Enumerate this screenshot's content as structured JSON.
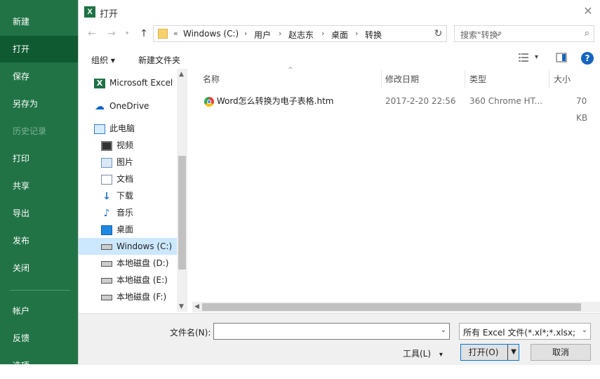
{
  "backstage": {
    "items": [
      {
        "label": "新建"
      },
      {
        "label": "打开"
      },
      {
        "label": "保存"
      },
      {
        "label": "另存为"
      },
      {
        "label": "历史记录"
      },
      {
        "label": "打印"
      },
      {
        "label": "共享"
      },
      {
        "label": "导出"
      },
      {
        "label": "发布"
      },
      {
        "label": "关闭"
      },
      {
        "label": "帐户"
      },
      {
        "label": "反馈"
      },
      {
        "label": "选项"
      }
    ],
    "active": "打开",
    "accent": "#217346"
  },
  "dialog": {
    "title": "打开",
    "address": {
      "prefix": "«",
      "crumbs": [
        "Windows (C:)",
        "用户",
        "赵志东",
        "桌面",
        "转换"
      ]
    },
    "search_placeholder": "搜索\"转换\"",
    "toolbar": {
      "organize": "组织 ▾",
      "new_folder": "新建文件夹"
    },
    "nav": [
      {
        "label": "Microsoft Excel",
        "icon": "excel-icon"
      },
      {
        "label": "OneDrive",
        "icon": "cloud-icon"
      },
      {
        "label": "此电脑",
        "icon": "computer-icon"
      },
      {
        "label": "视频",
        "icon": "video-icon"
      },
      {
        "label": "图片",
        "icon": "picture-icon"
      },
      {
        "label": "文档",
        "icon": "document-icon"
      },
      {
        "label": "下载",
        "icon": "download-icon"
      },
      {
        "label": "音乐",
        "icon": "music-icon"
      },
      {
        "label": "桌面",
        "icon": "desktop-icon"
      },
      {
        "label": "Windows (C:)",
        "icon": "drive-icon",
        "selected": true
      },
      {
        "label": "本地磁盘 (D:)",
        "icon": "drive-icon"
      },
      {
        "label": "本地磁盘 (E:)",
        "icon": "drive-icon"
      },
      {
        "label": "本地磁盘 (F:)",
        "icon": "drive-icon"
      }
    ],
    "columns": [
      "名称",
      "修改日期",
      "类型",
      "大小"
    ],
    "files": [
      {
        "name": "Word怎么转换为电子表格.htm",
        "date": "2017-2-20 22:56",
        "type": "360 Chrome HT...",
        "size": "70 KB"
      }
    ],
    "filename_label": "文件名(N):",
    "filename_value": "",
    "filter": "所有 Excel 文件(*.xl*;*.xlsx;*.xl",
    "tools": "工具(L)",
    "open": "打开(O)",
    "cancel": "取消"
  }
}
